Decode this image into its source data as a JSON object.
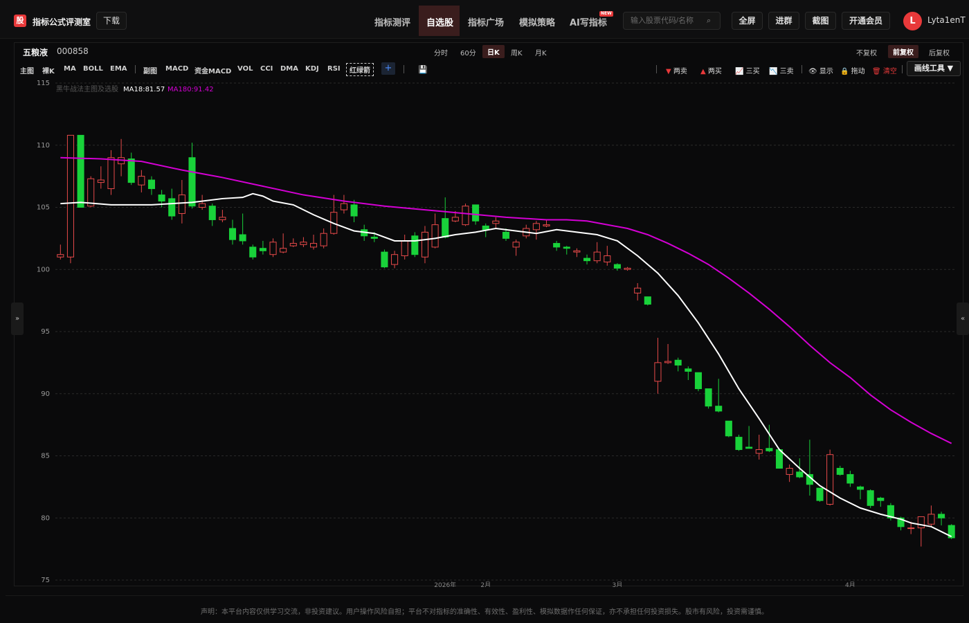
{
  "app": {
    "logo_char": "股",
    "brand": "指标公式评测室",
    "download": "下载"
  },
  "nav": {
    "items": [
      "指标测评",
      "自选股",
      "指标广场",
      "模拟策略",
      "AI写指标"
    ],
    "active": "自选股",
    "new_badge": "NEW",
    "search_placeholder": "输入股票代码/名称",
    "buttons": [
      "全屏",
      "进群",
      "截图",
      "开通会员"
    ],
    "avatar_initial": "L",
    "username": "Lyta1enT"
  },
  "stock": {
    "name": "五粮液",
    "code": "000858"
  },
  "periods": [
    "分时",
    "60分",
    "日K",
    "周K",
    "月K"
  ],
  "period_active": "日K",
  "adjust": [
    "不复权",
    "前复权",
    "后复权"
  ],
  "adjust_active": "前复权",
  "indicators": {
    "main_label": "主图",
    "main": [
      "裸K",
      "MA",
      "BOLL",
      "EMA"
    ],
    "sub_label": "副图",
    "sub": [
      "MACD",
      "资金MACD",
      "VOL",
      "CCI",
      "DMA",
      "KDJ",
      "RSI"
    ],
    "boxed": "红绿箭",
    "add": "+"
  },
  "drawing": {
    "tools": [
      "两卖",
      "两买",
      "三买",
      "三卖",
      "显示",
      "拖动",
      "清空"
    ],
    "menu": "画线工具 ▼"
  },
  "legend": {
    "strategy": "黑牛战法主图及选股",
    "ma18": "MA18:81.57",
    "ma180": "MA180:91.42",
    "ma18_color": "#ffffff",
    "ma180_color": "#d400d4"
  },
  "side_tabs": {
    "left": "»",
    "right": "«"
  },
  "disclaimer": "声明：本平台内容仅供学习交流，非投资建议。用户操作风险自担；平台不对指标的准确性、有效性、盈利性、模拟数据作任何保证，亦不承担任何投资损失。股市有风险，投资需谨慎。",
  "chart_data": {
    "type": "candlestick",
    "y_ticks": [
      115,
      110,
      105,
      100,
      95,
      90,
      85,
      80,
      75
    ],
    "ylim": [
      75,
      115
    ],
    "x_labels": [
      "2026年",
      "2月",
      "3月",
      "4月"
    ],
    "up_color": "#e84a4a",
    "down_color": "#19d23a",
    "candles": [
      [
        101,
        101.2,
        102,
        100.8
      ],
      [
        101,
        110.8,
        110.8,
        100.5
      ],
      [
        110.8,
        105,
        110.8,
        105
      ],
      [
        105.1,
        107.3,
        107.5,
        105
      ],
      [
        107,
        107.2,
        108.3,
        106.5
      ],
      [
        106.5,
        109,
        109.6,
        106
      ],
      [
        108.5,
        109,
        110.5,
        107.5
      ],
      [
        108.9,
        107,
        109.4,
        106.8
      ],
      [
        106.8,
        107.5,
        108,
        106.2
      ],
      [
        107.2,
        106.5,
        107.5,
        106
      ],
      [
        106,
        105.5,
        106.4,
        105
      ],
      [
        105.7,
        104.3,
        106.5,
        104
      ],
      [
        104.5,
        106,
        107.2,
        103.7
      ],
      [
        109,
        105.1,
        110.2,
        104.9
      ],
      [
        105,
        105.3,
        106,
        104.8
      ],
      [
        105.1,
        104,
        105.3,
        103.5
      ],
      [
        104,
        104.2,
        104.8,
        103.8
      ],
      [
        103.3,
        102.4,
        104,
        102
      ],
      [
        102.8,
        102.3,
        104.5,
        102
      ],
      [
        101.8,
        101,
        102,
        100.8
      ],
      [
        101.7,
        101.5,
        102.3,
        101.2
      ],
      [
        101.2,
        102.2,
        102.5,
        101
      ],
      [
        101.4,
        101.7,
        102.9,
        101.3
      ],
      [
        101.9,
        102.1,
        102.5,
        101.8
      ],
      [
        102,
        102.2,
        102.6,
        101.8
      ],
      [
        101.8,
        102.1,
        102.8,
        101.6
      ],
      [
        101.9,
        102.9,
        103.3,
        101.7
      ],
      [
        102.9,
        104.6,
        106,
        102.8
      ],
      [
        104.8,
        105.3,
        106,
        104.5
      ],
      [
        105.2,
        104.3,
        105.6,
        103.8
      ],
      [
        103.2,
        102.7,
        103.6,
        102.3
      ],
      [
        102.6,
        102.5,
        103,
        102.2
      ],
      [
        101.4,
        100.2,
        101.6,
        100.1
      ],
      [
        100.4,
        101.2,
        101.5,
        100.1
      ],
      [
        101.1,
        102.3,
        102.8,
        100.8
      ],
      [
        102.7,
        101.2,
        103,
        101
      ],
      [
        101,
        103,
        103.5,
        100.5
      ],
      [
        101.8,
        103.6,
        104.5,
        101.7
      ],
      [
        104.1,
        102.6,
        105.8,
        102.5
      ],
      [
        103.9,
        104.2,
        104.7,
        103.8
      ],
      [
        103.6,
        105.1,
        105.3,
        103.5
      ],
      [
        105.2,
        103.9,
        105.2,
        103.6
      ],
      [
        103.5,
        103.2,
        103.7,
        102.6
      ],
      [
        103.7,
        103.9,
        104.2,
        103.3
      ],
      [
        103,
        102.5,
        103.3,
        102.3
      ],
      [
        101.8,
        102.2,
        102.4,
        101.1
      ],
      [
        102.7,
        103.3,
        103.6,
        102.5
      ],
      [
        103.2,
        103.7,
        103.9,
        102.4
      ],
      [
        103.5,
        103.6,
        104,
        103.4
      ],
      [
        102.1,
        101.8,
        102.3,
        101.5
      ],
      [
        101.8,
        101.7,
        101.9,
        101.2
      ],
      [
        101.4,
        101.5,
        101.7,
        101
      ],
      [
        100.9,
        100.7,
        101.2,
        100.4
      ],
      [
        100.7,
        101.4,
        102.2,
        100.5
      ],
      [
        100.6,
        101.1,
        101.9,
        100.3
      ],
      [
        100.4,
        100.1,
        100.5,
        99.9
      ],
      [
        100,
        100.1,
        100.2,
        99.9
      ],
      [
        98.1,
        98.5,
        98.9,
        97.5
      ],
      [
        97.8,
        97.2,
        97.8,
        97.1
      ],
      [
        91,
        92.5,
        94.5,
        90
      ],
      [
        92.5,
        92.6,
        94,
        92.4
      ],
      [
        92.7,
        92.3,
        92.9,
        91.8
      ],
      [
        92,
        91.8,
        92.2,
        91.1
      ],
      [
        91.7,
        90.4,
        91.7,
        90.2
      ],
      [
        90.4,
        89,
        90.4,
        88.8
      ],
      [
        89,
        88.6,
        91.2,
        88.5
      ],
      [
        87.8,
        86.6,
        87.8,
        86.5
      ],
      [
        86.5,
        85.5,
        86.7,
        85.4
      ],
      [
        85.7,
        85.6,
        87.4,
        85.6
      ],
      [
        85.2,
        85.5,
        86.7,
        84.7
      ],
      [
        85.6,
        85.4,
        87.5,
        85.3
      ],
      [
        85.5,
        84,
        85.6,
        84
      ],
      [
        83.5,
        84,
        84.3,
        82.9
      ],
      [
        83.7,
        83.3,
        84.8,
        83.2
      ],
      [
        83.5,
        82.7,
        86.3,
        81.8
      ],
      [
        82.4,
        81.4,
        82.4,
        81.3
      ],
      [
        81.1,
        85.1,
        85.5,
        81
      ],
      [
        84,
        83.5,
        84.2,
        83.4
      ],
      [
        83.5,
        82.8,
        83.8,
        82.5
      ],
      [
        82.5,
        82.3,
        82.6,
        81.5
      ],
      [
        82.2,
        81,
        82.3,
        80.8
      ],
      [
        81.6,
        81.4,
        81.7,
        80.9
      ],
      [
        81,
        80,
        81.2,
        79.8
      ],
      [
        80,
        79.3,
        80.1,
        79
      ],
      [
        79.2,
        79.2,
        79.7,
        78.7
      ],
      [
        79.2,
        80.1,
        80.1,
        77.7
      ],
      [
        79.5,
        80.3,
        81,
        79.3
      ],
      [
        80.3,
        80,
        80.5,
        79.4
      ],
      [
        79.4,
        78.4,
        79.5,
        78.3
      ]
    ],
    "ma18": [
      [
        0,
        105.3
      ],
      [
        2,
        105.4
      ],
      [
        5,
        105.2
      ],
      [
        9,
        105.2
      ],
      [
        13,
        105.4
      ],
      [
        16,
        105.7
      ],
      [
        18,
        105.8
      ],
      [
        19,
        106.1
      ],
      [
        20,
        105.9
      ],
      [
        21,
        105.5
      ],
      [
        23,
        105.2
      ],
      [
        25,
        104.4
      ],
      [
        27,
        103.7
      ],
      [
        29,
        103.1
      ],
      [
        31,
        102.9
      ],
      [
        33,
        102.3
      ],
      [
        35,
        102.3
      ],
      [
        37,
        102.5
      ],
      [
        39,
        102.8
      ],
      [
        41,
        103.0
      ],
      [
        43,
        103.3
      ],
      [
        45,
        103.1
      ],
      [
        47,
        102.9
      ],
      [
        49,
        103.2
      ],
      [
        51,
        103.0
      ],
      [
        53,
        102.8
      ],
      [
        55,
        102.3
      ],
      [
        57,
        101.1
      ],
      [
        59,
        99.7
      ],
      [
        61,
        97.9
      ],
      [
        63,
        95.7
      ],
      [
        65,
        93.2
      ],
      [
        67,
        90.4
      ],
      [
        69,
        88.0
      ],
      [
        71,
        85.5
      ],
      [
        73,
        84.0
      ],
      [
        75,
        82.6
      ],
      [
        77,
        81.6
      ],
      [
        79,
        80.8
      ],
      [
        81,
        80.3
      ],
      [
        83,
        79.9
      ],
      [
        84,
        79.6
      ],
      [
        86,
        79.3
      ],
      [
        88,
        78.5
      ]
    ],
    "ma180": [
      [
        0,
        109.0
      ],
      [
        4,
        108.9
      ],
      [
        8,
        108.7
      ],
      [
        12,
        108.0
      ],
      [
        16,
        107.4
      ],
      [
        20,
        106.7
      ],
      [
        24,
        106.0
      ],
      [
        28,
        105.5
      ],
      [
        32,
        105.1
      ],
      [
        36,
        104.8
      ],
      [
        40,
        104.5
      ],
      [
        44,
        104.2
      ],
      [
        48,
        104.0
      ],
      [
        50,
        104.0
      ],
      [
        52,
        103.9
      ],
      [
        54,
        103.6
      ],
      [
        56,
        103.3
      ],
      [
        58,
        102.8
      ],
      [
        60,
        102.1
      ],
      [
        62,
        101.3
      ],
      [
        64,
        100.4
      ],
      [
        66,
        99.3
      ],
      [
        68,
        98.1
      ],
      [
        70,
        96.8
      ],
      [
        72,
        95.4
      ],
      [
        74,
        93.9
      ],
      [
        76,
        92.5
      ],
      [
        78,
        91.3
      ],
      [
        80,
        89.9
      ],
      [
        82,
        88.7
      ],
      [
        84,
        87.7
      ],
      [
        86,
        86.8
      ],
      [
        88,
        86.0
      ]
    ]
  }
}
